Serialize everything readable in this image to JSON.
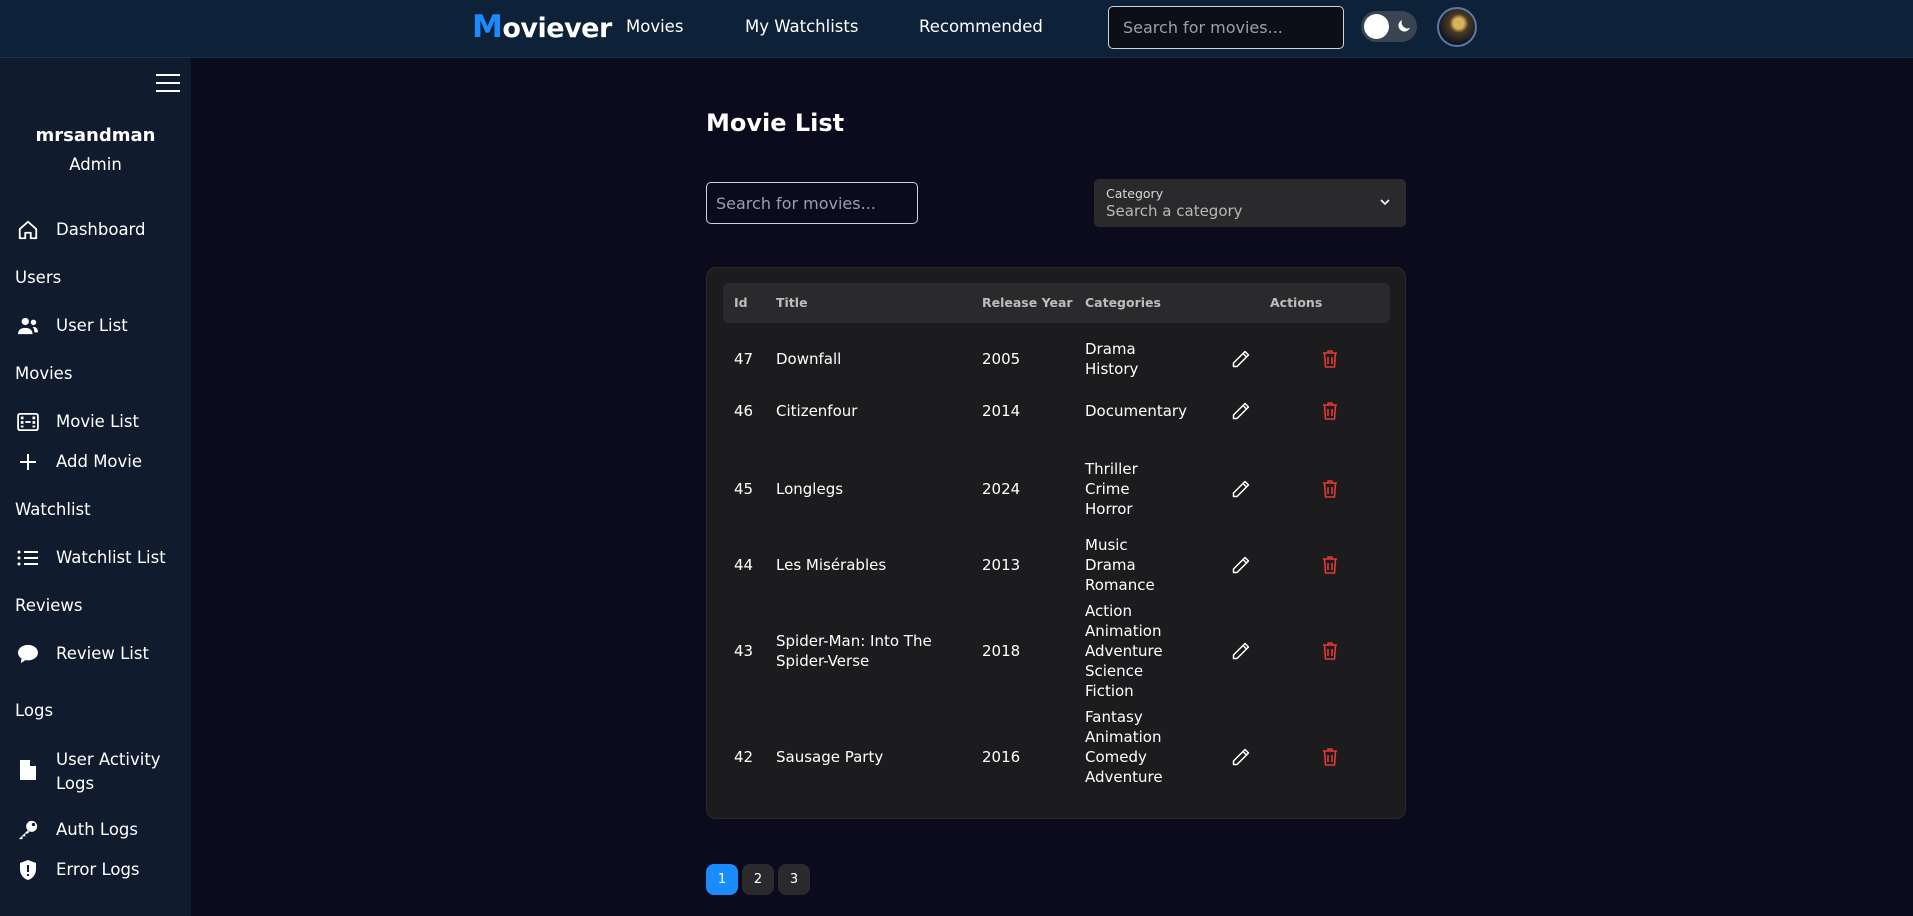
{
  "nav": {
    "brand_first": "M",
    "brand_rest": "oviever",
    "links": [
      "Movies",
      "My Watchlists",
      "Recommended"
    ],
    "search_placeholder": "Search for movies..."
  },
  "sidebar": {
    "user_name": "mrsandman",
    "user_role": "Admin",
    "dashboard": "Dashboard",
    "sections": [
      "Users",
      "Movies",
      "Watchlist",
      "Reviews",
      "Logs"
    ],
    "items": {
      "user_list": "User List",
      "movie_list": "Movie List",
      "add_movie": "Add Movie",
      "watchlist_list": "Watchlist List",
      "review_list": "Review List",
      "user_activity_logs": "User Activity Logs",
      "auth_logs": "Auth Logs",
      "error_logs": "Error Logs"
    }
  },
  "main": {
    "title": "Movie List",
    "search_placeholder": "Search for movies...",
    "category_label": "Category",
    "category_placeholder": "Search a category",
    "columns": [
      "Id",
      "Title",
      "Release Year",
      "Categories",
      "Actions"
    ],
    "rows": [
      {
        "id": "47",
        "title": "Downfall",
        "year": "2005",
        "categories": [
          "Drama",
          "History"
        ]
      },
      {
        "id": "46",
        "title": "Citizenfour",
        "year": "2014",
        "categories": [
          "Documentary"
        ]
      },
      {
        "id": "45",
        "title": "Longlegs",
        "year": "2024",
        "categories": [
          "Thriller",
          "Crime",
          "Horror"
        ]
      },
      {
        "id": "44",
        "title": "Les Misérables",
        "year": "2013",
        "categories": [
          "Music",
          "Drama",
          "Romance"
        ]
      },
      {
        "id": "43",
        "title": "Spider-Man: Into The Spider-Verse",
        "year": "2018",
        "categories": [
          "Action",
          "Animation",
          "Adventure",
          "Science Fiction"
        ]
      },
      {
        "id": "42",
        "title": "Sausage Party",
        "year": "2016",
        "categories": [
          "Fantasy",
          "Animation",
          "Comedy",
          "Adventure"
        ]
      }
    ],
    "pagination": [
      "1",
      "2",
      "3"
    ],
    "active_page": "1"
  },
  "colors": {
    "accent": "#1a8cff",
    "delete": "#e53935",
    "background": "#0c0b1d",
    "sidebar": "#101b2d",
    "navbar": "#0d2139"
  }
}
